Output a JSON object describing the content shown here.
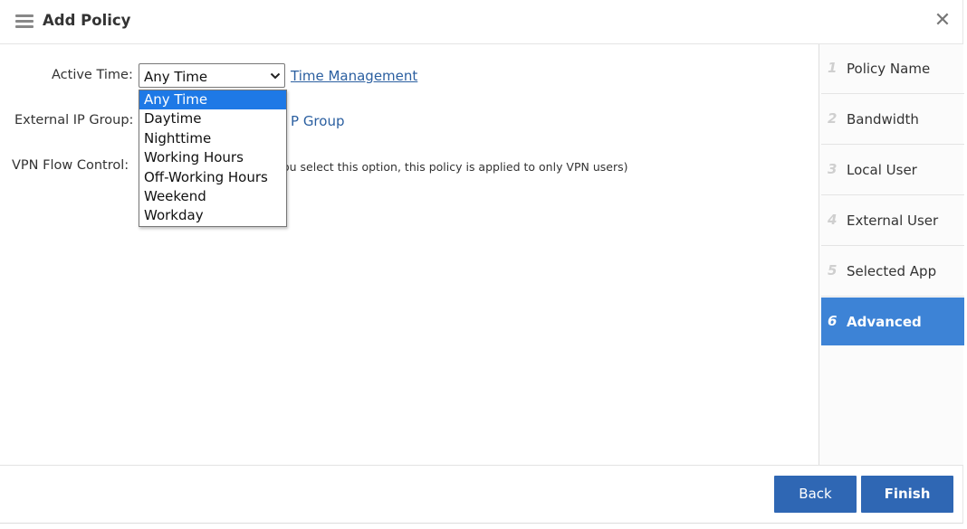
{
  "dialog": {
    "title": "Add Policy"
  },
  "form": {
    "active_time": {
      "label": "Active Time:",
      "value": "Any Time",
      "link": "Time Management"
    },
    "external_ip_group": {
      "label": "External IP Group:",
      "link_partial": "P Group"
    },
    "vpn_flow_control": {
      "label": "VPN Flow Control:",
      "hint_partial": "ou select this option, this policy is applied to only VPN users)"
    }
  },
  "dropdown": {
    "options": [
      "Any Time",
      "Daytime",
      "Nighttime",
      "Working Hours",
      "Off-Working Hours",
      "Weekend",
      "Workday"
    ],
    "selected": "Any Time"
  },
  "steps": [
    {
      "num": "1",
      "label": "Policy Name"
    },
    {
      "num": "2",
      "label": "Bandwidth"
    },
    {
      "num": "3",
      "label": "Local User"
    },
    {
      "num": "4",
      "label": "External User"
    },
    {
      "num": "5",
      "label": "Selected App"
    },
    {
      "num": "6",
      "label": "Advanced"
    }
  ],
  "active_step": "6",
  "footer": {
    "back_label": "Back",
    "finish_label": "Finish"
  },
  "colors": {
    "accent": "#3d83d6",
    "button": "#2f67b4",
    "link": "#2b5fa0",
    "dropdown_highlight": "#1e79e6"
  }
}
